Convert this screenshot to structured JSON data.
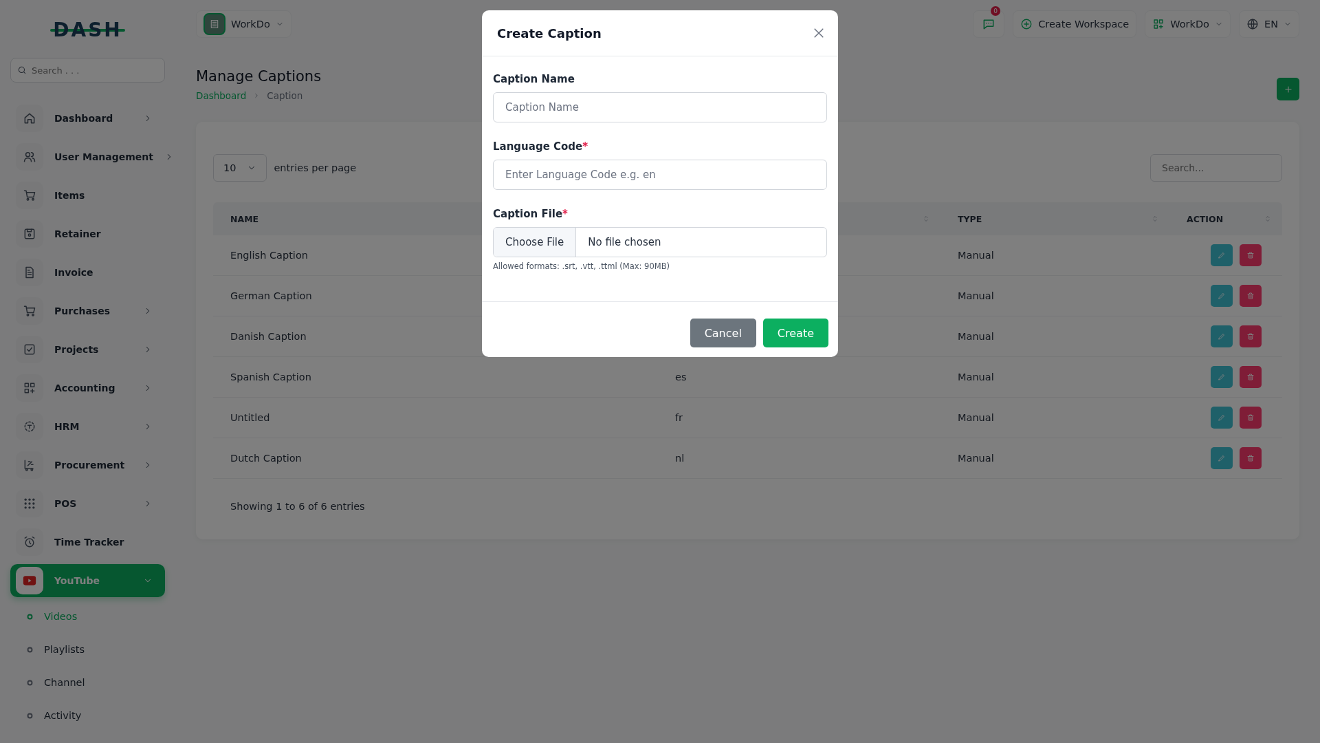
{
  "logo": "DASH",
  "header": {
    "workspace": "WorkDo",
    "notification_count": "0",
    "create_workspace": "Create Workspace",
    "workspace_menu": "WorkDo",
    "language": "EN"
  },
  "sidebar": {
    "search_placeholder": "Search . . .",
    "items": [
      {
        "label": "Dashboard",
        "expanded": false,
        "selected": false
      },
      {
        "label": "User Management",
        "expanded": false,
        "selected": false
      },
      {
        "label": "Items",
        "selected": false
      },
      {
        "label": "Retainer",
        "selected": false
      },
      {
        "label": "Invoice",
        "selected": false
      },
      {
        "label": "Purchases",
        "expanded": false,
        "selected": false
      },
      {
        "label": "Projects",
        "expanded": false,
        "selected": false
      },
      {
        "label": "Accounting",
        "expanded": false,
        "selected": false
      },
      {
        "label": "HRM",
        "expanded": false,
        "selected": false
      },
      {
        "label": "Procurement",
        "expanded": false,
        "selected": false
      },
      {
        "label": "POS",
        "expanded": false,
        "selected": false
      },
      {
        "label": "Time Tracker",
        "selected": false
      },
      {
        "label": "YouTube",
        "expanded": true,
        "selected": true,
        "children": [
          {
            "label": "Videos",
            "selected": true
          },
          {
            "label": "Playlists",
            "selected": false
          },
          {
            "label": "Channel",
            "selected": false
          },
          {
            "label": "Activity",
            "selected": false
          }
        ]
      }
    ]
  },
  "page": {
    "title": "Manage Captions",
    "breadcrumb": [
      "Dashboard",
      "Caption"
    ]
  },
  "table": {
    "entries_per_page": "10",
    "entries_label": "entries per page",
    "search_placeholder": "Search...",
    "columns": [
      {
        "label": "NAME"
      },
      {
        "sortable": true
      },
      {
        "label": "TYPE",
        "sortable": true
      },
      {
        "label": "ACTION",
        "sortable": true
      }
    ],
    "rows": [
      {
        "name": "English Caption",
        "type": "Manual"
      },
      {
        "name": "German Caption",
        "type": "Manual"
      },
      {
        "name": "Danish Caption",
        "type": "Manual"
      },
      {
        "name": "Spanish Caption",
        "code": "es",
        "type": "Manual"
      },
      {
        "name": "Untitled",
        "code": "fr",
        "type": "Manual"
      },
      {
        "name": "Dutch Caption",
        "code": "nl",
        "type": "Manual"
      }
    ],
    "footer": "Showing 1 to 6 of 6 entries"
  },
  "modal": {
    "title": "Create Caption",
    "fields": [
      {
        "kind": "text",
        "label": "Caption Name",
        "placeholder": "Caption Name"
      },
      {
        "kind": "text",
        "label": "Language Code",
        "required_mark": "*",
        "placeholder": "Enter Language Code e.g. en"
      },
      {
        "kind": "file",
        "label": "Caption File",
        "required_mark": "*",
        "button": "Choose File",
        "status": "No file chosen",
        "hint": "Allowed formats: .srt, .vtt, .ttml (Max: 90MB)"
      }
    ],
    "buttons": [
      {
        "label": "Cancel",
        "kind": "secondary"
      },
      {
        "label": "Create",
        "kind": "primary"
      }
    ]
  }
}
